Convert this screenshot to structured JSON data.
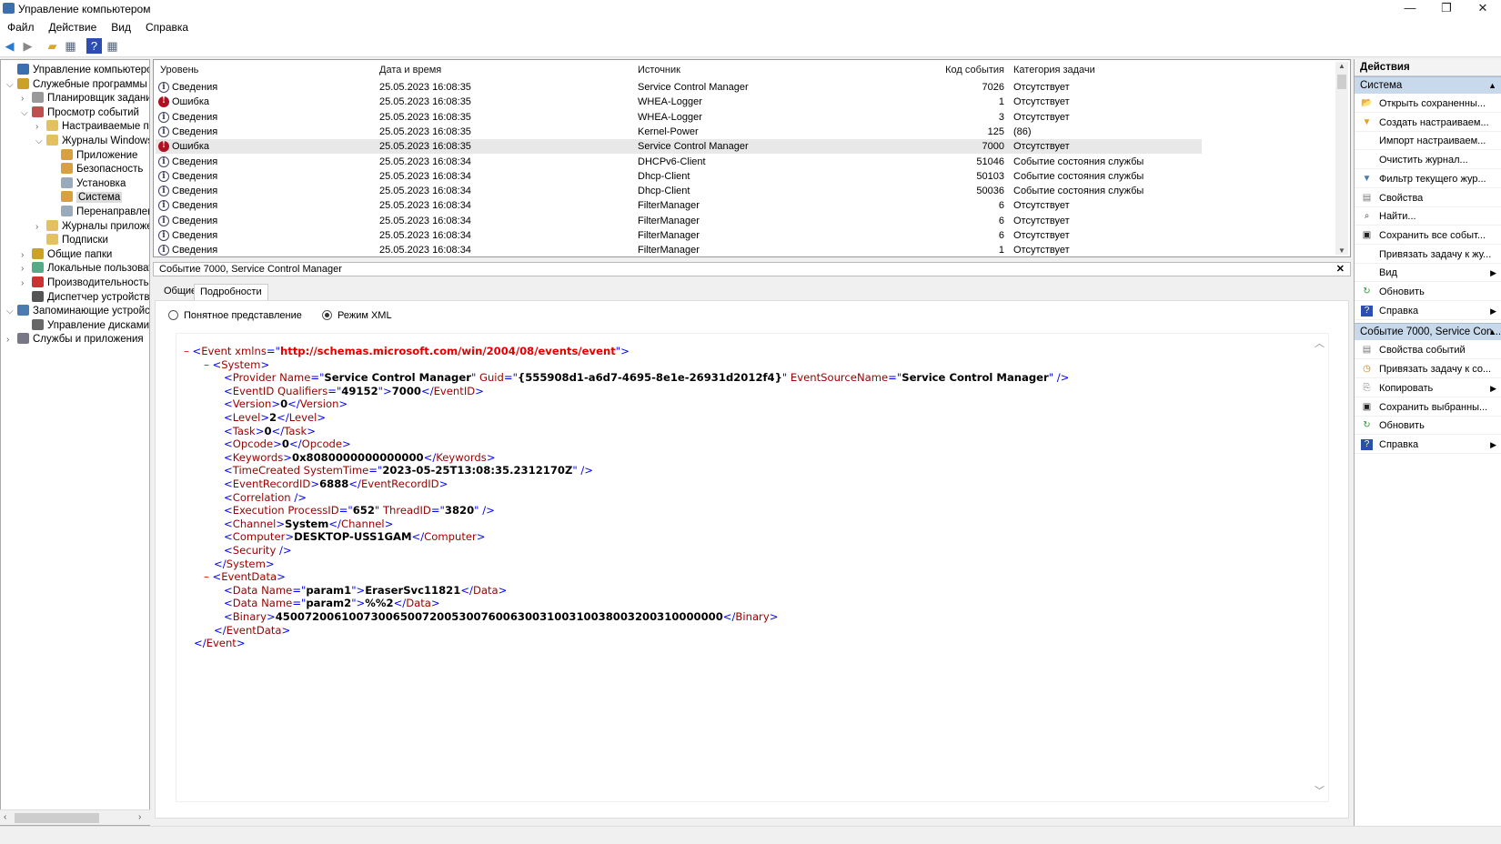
{
  "window": {
    "title": "Управление компьютером",
    "minimize": "—",
    "restore": "❐",
    "close": "✕"
  },
  "menu": [
    "Файл",
    "Действие",
    "Вид",
    "Справка"
  ],
  "tree": [
    {
      "label": "Управление компьютером (л",
      "level": 0,
      "arrow": "",
      "color": "#3a6fb0"
    },
    {
      "label": "Служебные программы",
      "level": 0,
      "arrow": "⌵",
      "color": "#c9a227"
    },
    {
      "label": "Планировщик заданий",
      "level": 1,
      "arrow": "›",
      "color": "#999"
    },
    {
      "label": "Просмотр событий",
      "level": 1,
      "arrow": "⌵",
      "color": "#c0504d"
    },
    {
      "label": "Настраиваемые пр",
      "level": 2,
      "arrow": "›",
      "color": "#e3c060"
    },
    {
      "label": "Журналы Windows",
      "level": 2,
      "arrow": "⌵",
      "color": "#e3c060"
    },
    {
      "label": "Приложение",
      "level": 3,
      "arrow": "",
      "color": "#d8a040"
    },
    {
      "label": "Безопасность",
      "level": 3,
      "arrow": "",
      "color": "#d8a040"
    },
    {
      "label": "Установка",
      "level": 3,
      "arrow": "",
      "color": "#9ab"
    },
    {
      "label": "Система",
      "level": 3,
      "arrow": "",
      "color": "#d8a040",
      "selected": true
    },
    {
      "label": "Перенаправлен",
      "level": 3,
      "arrow": "",
      "color": "#9ab"
    },
    {
      "label": "Журналы приложе",
      "level": 2,
      "arrow": "›",
      "color": "#e3c060"
    },
    {
      "label": "Подписки",
      "level": 2,
      "arrow": "",
      "color": "#e3c060"
    },
    {
      "label": "Общие папки",
      "level": 1,
      "arrow": "›",
      "color": "#c9a227"
    },
    {
      "label": "Локальные пользовате",
      "level": 1,
      "arrow": "›",
      "color": "#5a8"
    },
    {
      "label": "Производительность",
      "level": 1,
      "arrow": "›",
      "color": "#c33"
    },
    {
      "label": "Диспетчер устройств",
      "level": 1,
      "arrow": "",
      "color": "#555"
    },
    {
      "label": "Запоминающие устройст",
      "level": 0,
      "arrow": "⌵",
      "color": "#4a7bb0"
    },
    {
      "label": "Управление дисками",
      "level": 1,
      "arrow": "",
      "color": "#666"
    },
    {
      "label": "Службы и приложения",
      "level": 0,
      "arrow": "›",
      "color": "#778"
    }
  ],
  "list": {
    "headers": {
      "level": "Уровень",
      "date": "Дата и время",
      "source": "Источник",
      "code": "Код события",
      "category": "Категория задачи"
    },
    "rows": [
      {
        "type": "info",
        "level": "Сведения",
        "date": "25.05.2023 16:08:35",
        "source": "Service Control Manager",
        "code": "7026",
        "category": "Отсутствует"
      },
      {
        "type": "err",
        "level": "Ошибка",
        "date": "25.05.2023 16:08:35",
        "source": "WHEA-Logger",
        "code": "1",
        "category": "Отсутствует"
      },
      {
        "type": "info",
        "level": "Сведения",
        "date": "25.05.2023 16:08:35",
        "source": "WHEA-Logger",
        "code": "3",
        "category": "Отсутствует"
      },
      {
        "type": "info",
        "level": "Сведения",
        "date": "25.05.2023 16:08:35",
        "source": "Kernel-Power",
        "code": "125",
        "category": "(86)"
      },
      {
        "type": "err",
        "level": "Ошибка",
        "date": "25.05.2023 16:08:35",
        "source": "Service Control Manager",
        "code": "7000",
        "category": "Отсутствует",
        "selected": true
      },
      {
        "type": "info",
        "level": "Сведения",
        "date": "25.05.2023 16:08:34",
        "source": "DHCPv6-Client",
        "code": "51046",
        "category": "Событие состояния службы"
      },
      {
        "type": "info",
        "level": "Сведения",
        "date": "25.05.2023 16:08:34",
        "source": "Dhcp-Client",
        "code": "50103",
        "category": "Событие состояния службы"
      },
      {
        "type": "info",
        "level": "Сведения",
        "date": "25.05.2023 16:08:34",
        "source": "Dhcp-Client",
        "code": "50036",
        "category": "Событие состояния службы"
      },
      {
        "type": "info",
        "level": "Сведения",
        "date": "25.05.2023 16:08:34",
        "source": "FilterManager",
        "code": "6",
        "category": "Отсутствует"
      },
      {
        "type": "info",
        "level": "Сведения",
        "date": "25.05.2023 16:08:34",
        "source": "FilterManager",
        "code": "6",
        "category": "Отсутствует"
      },
      {
        "type": "info",
        "level": "Сведения",
        "date": "25.05.2023 16:08:34",
        "source": "FilterManager",
        "code": "6",
        "category": "Отсутствует"
      },
      {
        "type": "info",
        "level": "Сведения",
        "date": "25.05.2023 16:08:34",
        "source": "FilterManager",
        "code": "1",
        "category": "Отсутствует"
      }
    ]
  },
  "detail": {
    "title": "Событие 7000, Service Control Manager",
    "close": "✕",
    "tabs": [
      "Общие",
      "Подробности"
    ],
    "active_tab": 1,
    "radio_friendly": "Понятное представление",
    "radio_xml": "Режим XML",
    "xml": [
      [
        0,
        [
          [
            "m",
            "– "
          ],
          [
            "b",
            "<"
          ],
          [
            "t",
            "Event "
          ],
          [
            "a",
            "xmlns"
          ],
          [
            "b",
            "=\""
          ],
          [
            "u",
            "http://schemas.microsoft.com/win/2004/08/events/event"
          ],
          [
            "b",
            "\">"
          ]
        ]
      ],
      [
        1,
        [
          [
            "m",
            "– "
          ],
          [
            "b",
            "<"
          ],
          [
            "t",
            "System"
          ],
          [
            "b",
            ">"
          ]
        ]
      ],
      [
        2,
        [
          [
            "b",
            "<"
          ],
          [
            "t",
            "Provider "
          ],
          [
            "a",
            "Name"
          ],
          [
            "b",
            "=\""
          ],
          [
            "v",
            "Service Control Manager"
          ],
          [
            "b",
            "\" "
          ],
          [
            "a",
            "Guid"
          ],
          [
            "b",
            "=\""
          ],
          [
            "v",
            "{555908d1-a6d7-4695-8e1e-26931d2012f4}"
          ],
          [
            "b",
            "\" "
          ],
          [
            "a",
            "EventSourceName"
          ],
          [
            "b",
            "=\""
          ],
          [
            "v",
            "Service Control Manager"
          ],
          [
            "b",
            "\" />"
          ]
        ]
      ],
      [
        2,
        [
          [
            "b",
            "<"
          ],
          [
            "t",
            "EventID "
          ],
          [
            "a",
            "Qualifiers"
          ],
          [
            "b",
            "=\""
          ],
          [
            "v",
            "49152"
          ],
          [
            "b",
            "\">"
          ],
          [
            "v",
            "7000"
          ],
          [
            "b",
            "</"
          ],
          [
            "t",
            "EventID"
          ],
          [
            "b",
            ">"
          ]
        ]
      ],
      [
        2,
        [
          [
            "b",
            "<"
          ],
          [
            "t",
            "Version"
          ],
          [
            "b",
            ">"
          ],
          [
            "v",
            "0"
          ],
          [
            "b",
            "</"
          ],
          [
            "t",
            "Version"
          ],
          [
            "b",
            ">"
          ]
        ]
      ],
      [
        2,
        [
          [
            "b",
            "<"
          ],
          [
            "t",
            "Level"
          ],
          [
            "b",
            ">"
          ],
          [
            "v",
            "2"
          ],
          [
            "b",
            "</"
          ],
          [
            "t",
            "Level"
          ],
          [
            "b",
            ">"
          ]
        ]
      ],
      [
        2,
        [
          [
            "b",
            "<"
          ],
          [
            "t",
            "Task"
          ],
          [
            "b",
            ">"
          ],
          [
            "v",
            "0"
          ],
          [
            "b",
            "</"
          ],
          [
            "t",
            "Task"
          ],
          [
            "b",
            ">"
          ]
        ]
      ],
      [
        2,
        [
          [
            "b",
            "<"
          ],
          [
            "t",
            "Opcode"
          ],
          [
            "b",
            ">"
          ],
          [
            "v",
            "0"
          ],
          [
            "b",
            "</"
          ],
          [
            "t",
            "Opcode"
          ],
          [
            "b",
            ">"
          ]
        ]
      ],
      [
        2,
        [
          [
            "b",
            "<"
          ],
          [
            "t",
            "Keywords"
          ],
          [
            "b",
            ">"
          ],
          [
            "v",
            "0x8080000000000000"
          ],
          [
            "b",
            "</"
          ],
          [
            "t",
            "Keywords"
          ],
          [
            "b",
            ">"
          ]
        ]
      ],
      [
        2,
        [
          [
            "b",
            "<"
          ],
          [
            "t",
            "TimeCreated "
          ],
          [
            "a",
            "SystemTime"
          ],
          [
            "b",
            "=\""
          ],
          [
            "v",
            "2023-05-25T13:08:35.2312170Z"
          ],
          [
            "b",
            "\" />"
          ]
        ]
      ],
      [
        2,
        [
          [
            "b",
            "<"
          ],
          [
            "t",
            "EventRecordID"
          ],
          [
            "b",
            ">"
          ],
          [
            "v",
            "6888"
          ],
          [
            "b",
            "</"
          ],
          [
            "t",
            "EventRecordID"
          ],
          [
            "b",
            ">"
          ]
        ]
      ],
      [
        2,
        [
          [
            "b",
            "<"
          ],
          [
            "t",
            "Correlation "
          ],
          [
            "b",
            "/>"
          ]
        ]
      ],
      [
        2,
        [
          [
            "b",
            "<"
          ],
          [
            "t",
            "Execution "
          ],
          [
            "a",
            "ProcessID"
          ],
          [
            "b",
            "=\""
          ],
          [
            "v",
            "652"
          ],
          [
            "b",
            "\" "
          ],
          [
            "a",
            "ThreadID"
          ],
          [
            "b",
            "=\""
          ],
          [
            "v",
            "3820"
          ],
          [
            "b",
            "\" />"
          ]
        ]
      ],
      [
        2,
        [
          [
            "b",
            "<"
          ],
          [
            "t",
            "Channel"
          ],
          [
            "b",
            ">"
          ],
          [
            "v",
            "System"
          ],
          [
            "b",
            "</"
          ],
          [
            "t",
            "Channel"
          ],
          [
            "b",
            ">"
          ]
        ]
      ],
      [
        2,
        [
          [
            "b",
            "<"
          ],
          [
            "t",
            "Computer"
          ],
          [
            "b",
            ">"
          ],
          [
            "v",
            "DESKTOP-USS1GAM"
          ],
          [
            "b",
            "</"
          ],
          [
            "t",
            "Computer"
          ],
          [
            "b",
            ">"
          ]
        ]
      ],
      [
        2,
        [
          [
            "b",
            "<"
          ],
          [
            "t",
            "Security "
          ],
          [
            "b",
            "/>"
          ]
        ]
      ],
      [
        1.5,
        [
          [
            "b",
            "</"
          ],
          [
            "t",
            "System"
          ],
          [
            "b",
            ">"
          ]
        ]
      ],
      [
        1,
        [
          [
            "m",
            "– "
          ],
          [
            "b",
            "<"
          ],
          [
            "t",
            "EventData"
          ],
          [
            "b",
            ">"
          ]
        ]
      ],
      [
        2,
        [
          [
            "b",
            "<"
          ],
          [
            "t",
            "Data "
          ],
          [
            "a",
            "Name"
          ],
          [
            "b",
            "=\""
          ],
          [
            "v",
            "param1"
          ],
          [
            "b",
            "\">"
          ],
          [
            "v",
            "EraserSvc11821"
          ],
          [
            "b",
            "</"
          ],
          [
            "t",
            "Data"
          ],
          [
            "b",
            ">"
          ]
        ]
      ],
      [
        2,
        [
          [
            "b",
            "<"
          ],
          [
            "t",
            "Data "
          ],
          [
            "a",
            "Name"
          ],
          [
            "b",
            "=\""
          ],
          [
            "v",
            "param2"
          ],
          [
            "b",
            "\">"
          ],
          [
            "v",
            "%%2"
          ],
          [
            "b",
            "</"
          ],
          [
            "t",
            "Data"
          ],
          [
            "b",
            ">"
          ]
        ]
      ],
      [
        2,
        [
          [
            "b",
            "<"
          ],
          [
            "t",
            "Binary"
          ],
          [
            "b",
            ">"
          ],
          [
            "v",
            "4500720061007300650072005300760063003100310038003200310000000"
          ],
          [
            "b",
            "</"
          ],
          [
            "t",
            "Binary"
          ],
          [
            "b",
            ">"
          ]
        ]
      ],
      [
        1.5,
        [
          [
            "b",
            "</"
          ],
          [
            "t",
            "EventData"
          ],
          [
            "b",
            ">"
          ]
        ]
      ],
      [
        0.5,
        [
          [
            "b",
            "</"
          ],
          [
            "t",
            "Event"
          ],
          [
            "b",
            ">"
          ]
        ]
      ]
    ]
  },
  "actions": {
    "title": "Действия",
    "sections": [
      {
        "title": "Система",
        "items": [
          {
            "label": "Открыть сохраненны...",
            "icon": "folder-open-icon",
            "glyph": "📂",
            "color": "#d9a630"
          },
          {
            "label": "Создать настраиваем...",
            "icon": "filter-new-icon",
            "glyph": "▼",
            "color": "#e6a020"
          },
          {
            "label": "Импорт настраиваем...",
            "icon": "",
            "glyph": ""
          },
          {
            "label": "Очистить журнал...",
            "icon": "",
            "glyph": ""
          },
          {
            "label": "Фильтр текущего жур...",
            "icon": "filter-icon",
            "glyph": "▼",
            "color": "#4a7bb0"
          },
          {
            "label": "Свойства",
            "icon": "properties-icon",
            "glyph": "▤",
            "color": "#777"
          },
          {
            "label": "Найти...",
            "icon": "find-icon",
            "glyph": "⌕",
            "color": "#333"
          },
          {
            "label": "Сохранить все событ...",
            "icon": "save-icon",
            "glyph": "▣",
            "color": "#222"
          },
          {
            "label": "Привязать задачу к жу...",
            "icon": "",
            "glyph": ""
          },
          {
            "label": "Вид",
            "icon": "",
            "glyph": "",
            "sub": true
          },
          {
            "label": "Обновить",
            "icon": "refresh-icon",
            "glyph": "↻",
            "color": "#2a9a3a"
          },
          {
            "label": "Справка",
            "icon": "help-icon",
            "glyph": "?",
            "color": "#fff",
            "bg": "#2a4fb0",
            "sub": true
          }
        ]
      },
      {
        "title": "Событие 7000, Service Con...",
        "items": [
          {
            "label": "Свойства событий",
            "icon": "event-properties-icon",
            "glyph": "▤",
            "color": "#777"
          },
          {
            "label": "Привязать задачу к со...",
            "icon": "attach-task-icon",
            "glyph": "◷",
            "color": "#c08020"
          },
          {
            "label": "Копировать",
            "icon": "copy-icon",
            "glyph": "⎘",
            "color": "#777",
            "sub": true
          },
          {
            "label": "Сохранить выбранны...",
            "icon": "save-icon",
            "glyph": "▣",
            "color": "#222"
          },
          {
            "label": "Обновить",
            "icon": "refresh-icon",
            "glyph": "↻",
            "color": "#2a9a3a"
          },
          {
            "label": "Справка",
            "icon": "help-icon",
            "glyph": "?",
            "color": "#fff",
            "bg": "#2a4fb0",
            "sub": true
          }
        ]
      }
    ]
  }
}
